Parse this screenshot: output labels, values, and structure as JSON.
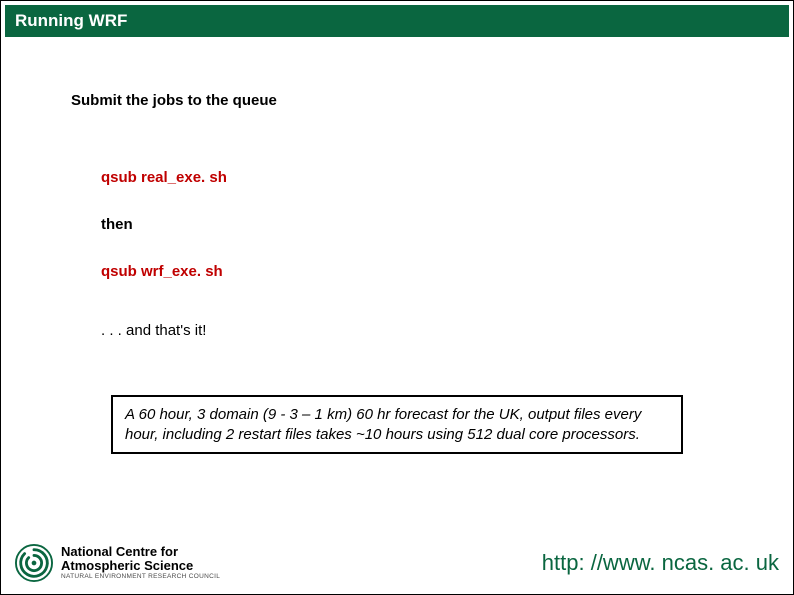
{
  "header": {
    "title": "Running WRF"
  },
  "body": {
    "instruction": "Submit the jobs to the queue",
    "cmd1": "qsub real_exe. sh",
    "then": "then",
    "cmd2": "qsub wrf_exe. sh",
    "thats_it": ". . . and that's it!",
    "info": "A 60 hour, 3 domain (9 - 3 – 1 km) 60 hr forecast for the UK, output files every hour, including 2 restart files takes ~10 hours using 512 dual core processors."
  },
  "footer": {
    "logo_line1": "National Centre for",
    "logo_line2": "Atmospheric Science",
    "logo_sub": "NATURAL ENVIRONMENT RESEARCH COUNCIL",
    "url": "http: //www. ncas. ac. uk"
  }
}
